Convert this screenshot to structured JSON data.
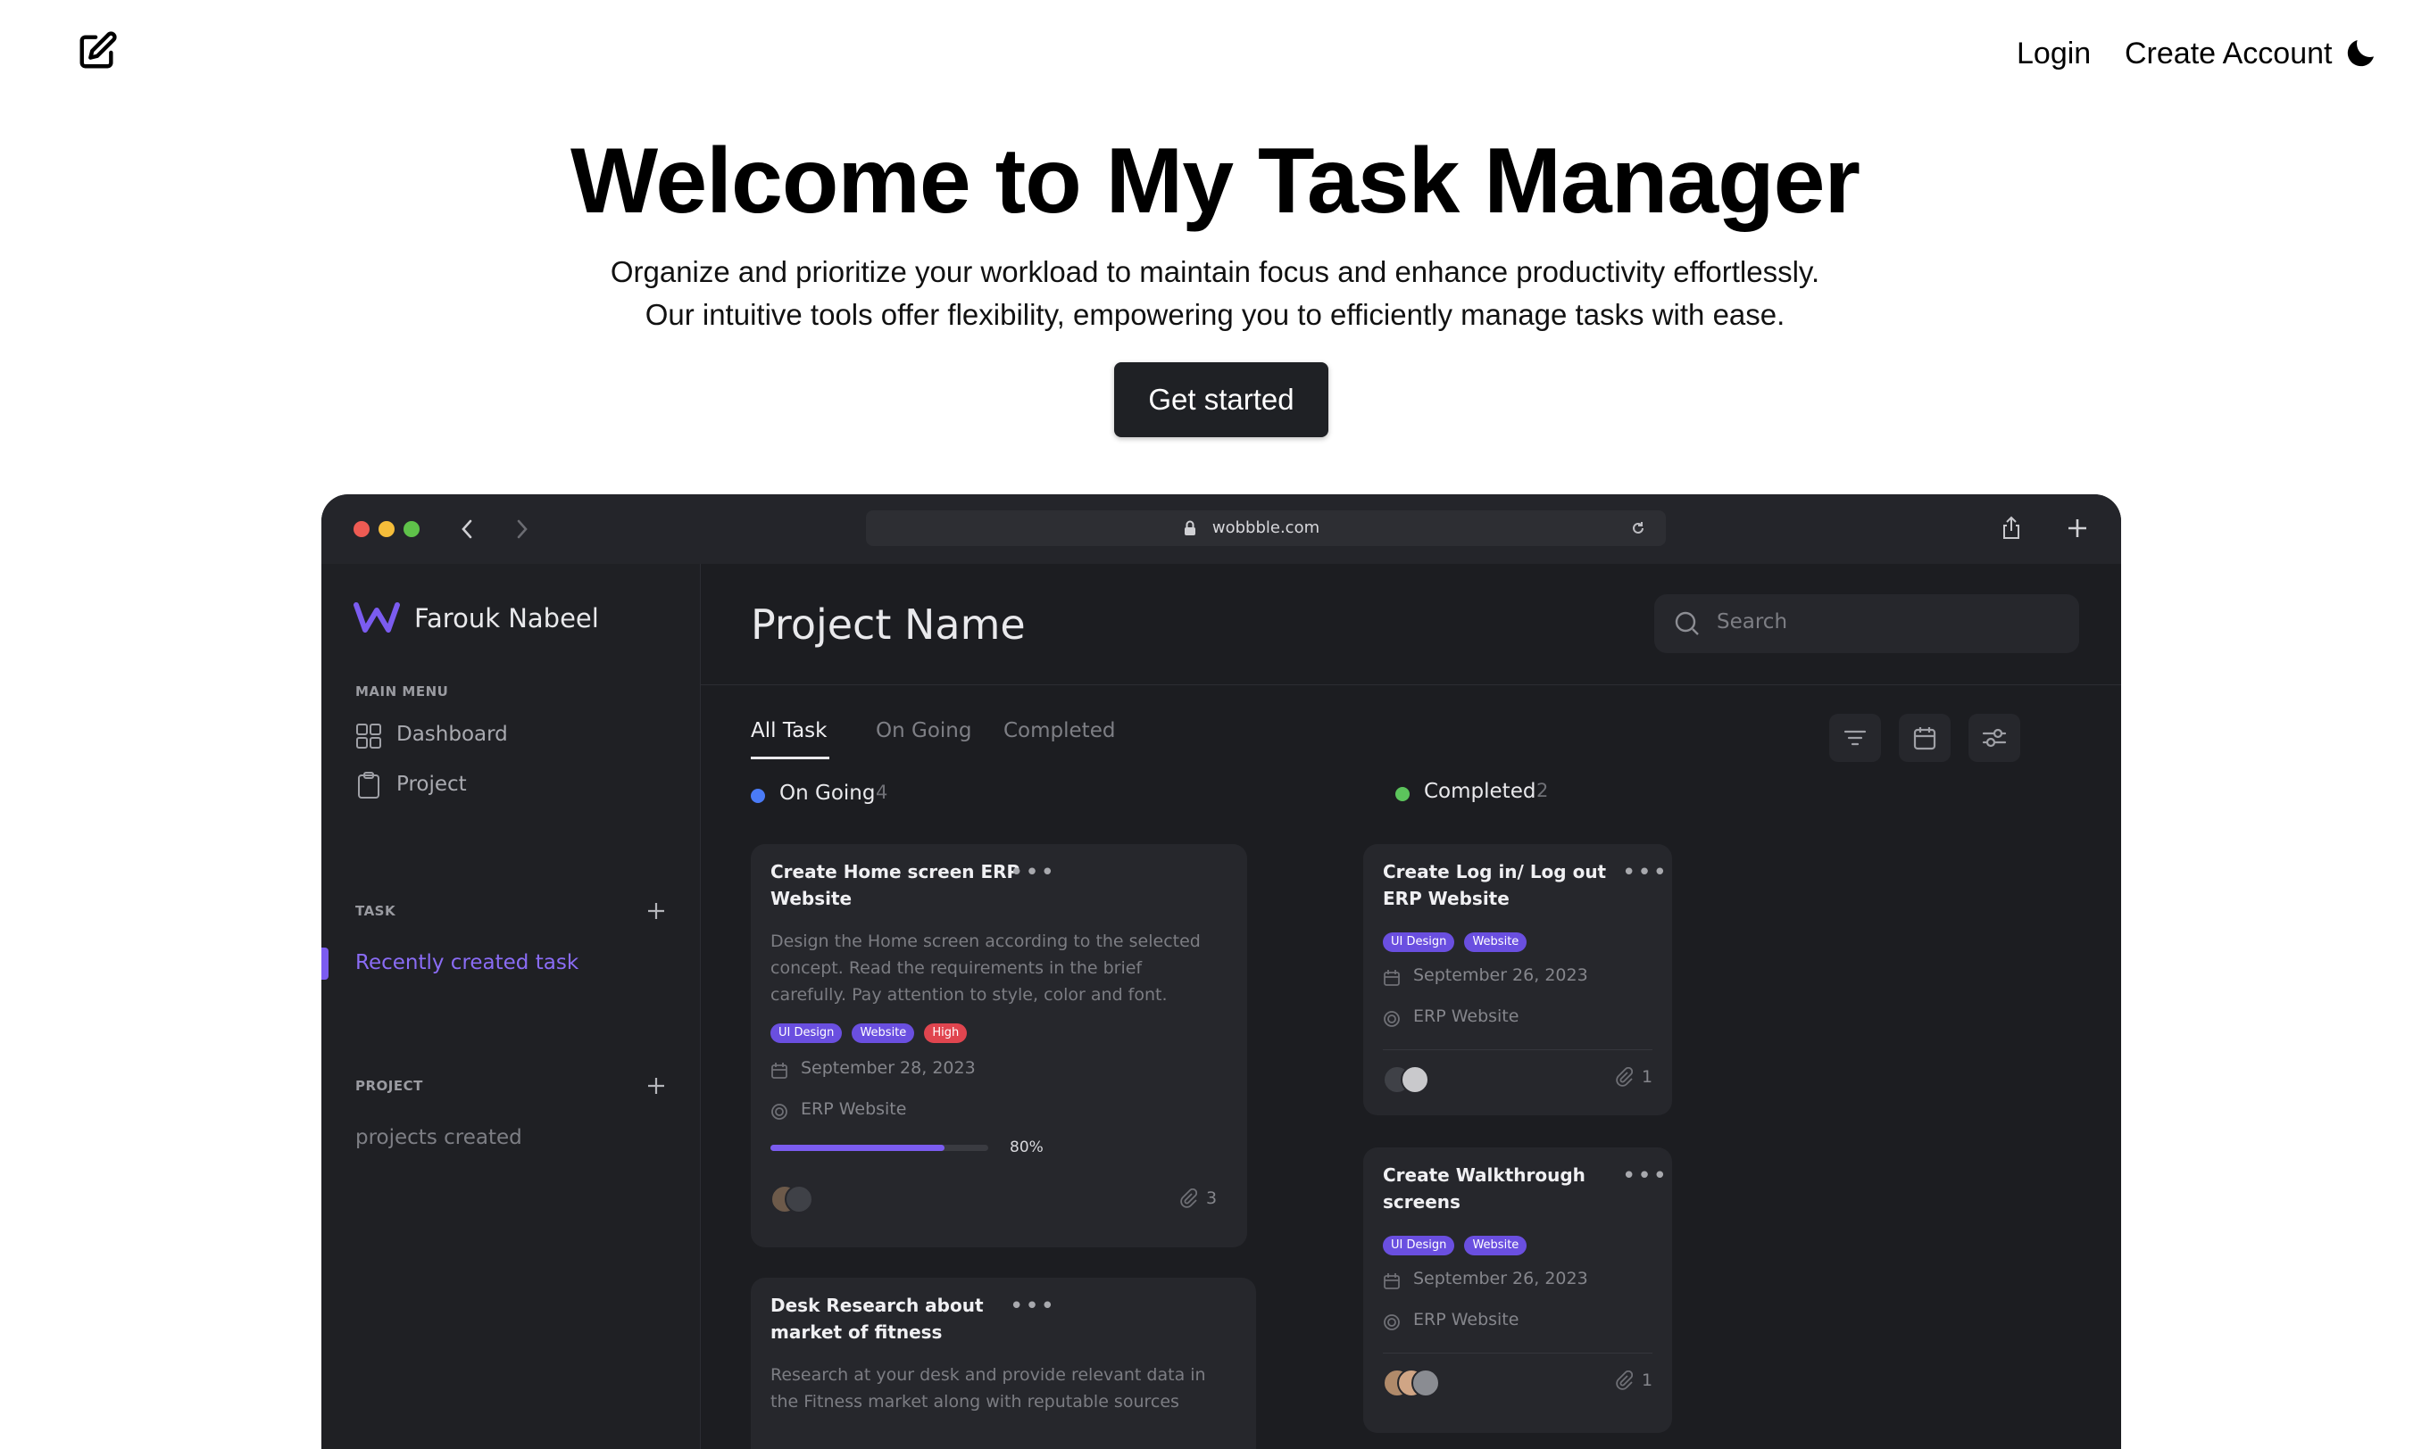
{
  "nav": {
    "login": "Login",
    "create_account": "Create Account"
  },
  "hero": {
    "title": "Welcome to My Task Manager",
    "line1": "Organize and prioritize your workload to maintain focus and enhance productivity effortlessly.",
    "line2": "Our intuitive tools offer flexibility, empowering you to efficiently manage tasks with ease.",
    "cta": "Get started"
  },
  "preview": {
    "url": "wobbble.com",
    "colors": {
      "accent": "#7b5cf0",
      "ongoing": "#4a7bf7",
      "completed": "#5cc45c",
      "high": "#e0454f"
    },
    "sidebar": {
      "user": "Farouk Nabeel",
      "main_menu": "MAIN MENU",
      "dashboard": "Dashboard",
      "project": "Project",
      "task_caption": "TASK",
      "recent_task": "Recently created task",
      "project_caption": "PROJECT",
      "projects_created": "projects created"
    },
    "header": {
      "title": "Project Name",
      "search_placeholder": "Search"
    },
    "tabs": [
      "All Task",
      "On Going",
      "Completed"
    ],
    "ongoing": {
      "label": "On Going",
      "count": "4",
      "cards": [
        {
          "title1": "Create Home screen ERP",
          "title2": "Website",
          "desc1": "Design the Home screen according to the selected",
          "desc2": "concept. Read the requirements in the brief",
          "desc3": "carefully. Pay attention to style, color and font.",
          "tags": [
            "UI Design",
            "Website",
            "High"
          ],
          "date": "September 28, 2023",
          "project": "ERP Website",
          "progress_label": "80%",
          "progress": 0.8,
          "attachments": "3"
        },
        {
          "title1": "Desk Research about",
          "title2": "market of fitness",
          "desc1": "Research at your desk and provide relevant data in",
          "desc2": "the Fitness market along with reputable sources"
        }
      ]
    },
    "completed": {
      "label": "Completed",
      "count": "2",
      "cards": [
        {
          "title1": "Create Log in/ Log out",
          "title2": "ERP Website",
          "tags": [
            "UI Design",
            "Website"
          ],
          "date": "September 26, 2023",
          "project": "ERP Website",
          "attachments": "1"
        },
        {
          "title1": "Create Walkthrough",
          "title2": "screens",
          "tags": [
            "UI Design",
            "Website"
          ],
          "date": "September 26, 2023",
          "project": "ERP Website",
          "attachments": "1"
        }
      ]
    }
  }
}
